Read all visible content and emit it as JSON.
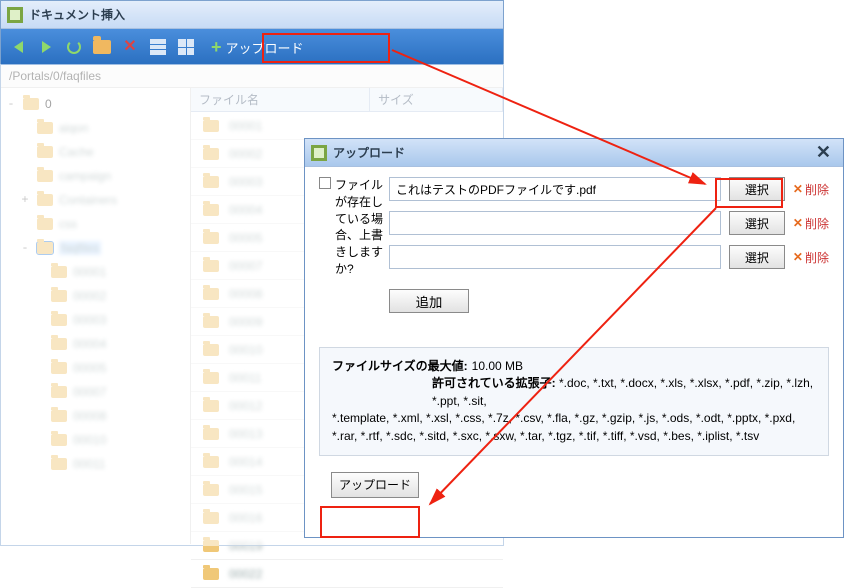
{
  "window": {
    "title": "ドキュメント挿入"
  },
  "toolbar": {
    "upload_label": "アップロード"
  },
  "path": "/Portals/0/faqfiles",
  "tree": {
    "root": "0",
    "items": [
      {
        "label": "aiqon",
        "depth": 1,
        "exp": null,
        "blur": true
      },
      {
        "label": "Cache",
        "depth": 1,
        "exp": null,
        "blur": true
      },
      {
        "label": "campaign",
        "depth": 1,
        "exp": null,
        "blur": true
      },
      {
        "label": "Containers",
        "depth": 1,
        "exp": "+",
        "blur": true
      },
      {
        "label": "css",
        "depth": 1,
        "exp": null,
        "blur": true
      },
      {
        "label": "faqfiles",
        "depth": 1,
        "exp": "-",
        "blur": true,
        "selected": true
      },
      {
        "label": "00001",
        "depth": 2,
        "exp": null,
        "blur": true
      },
      {
        "label": "00002",
        "depth": 2,
        "exp": null,
        "blur": true
      },
      {
        "label": "00003",
        "depth": 2,
        "exp": null,
        "blur": true
      },
      {
        "label": "00004",
        "depth": 2,
        "exp": null,
        "blur": true
      },
      {
        "label": "00005",
        "depth": 2,
        "exp": null,
        "blur": true
      },
      {
        "label": "00007",
        "depth": 2,
        "exp": null,
        "blur": true
      },
      {
        "label": "00008",
        "depth": 2,
        "exp": null,
        "blur": true
      },
      {
        "label": "00010",
        "depth": 2,
        "exp": null,
        "blur": true
      },
      {
        "label": "00011",
        "depth": 2,
        "exp": null,
        "blur": true
      }
    ]
  },
  "filepane": {
    "col_name": "ファイル名",
    "col_size": "サイズ",
    "rows": [
      "00001",
      "00002",
      "00003",
      "00004",
      "00005",
      "00007",
      "00008",
      "00009",
      "00010",
      "00011",
      "00012",
      "00013",
      "00014",
      "00015",
      "00016",
      "00019",
      "00022"
    ]
  },
  "dialog": {
    "title": "アップロード",
    "overwrite_prefix": "ファイルが存在している場合、上書きしますか?",
    "rows": [
      {
        "value": "これはテストのPDFファイルです.pdf"
      },
      {
        "value": ""
      },
      {
        "value": ""
      }
    ],
    "select_label": "選択",
    "delete_label": "削除",
    "add_label": "追加",
    "maxsize_label": "ファイルサイズの最大値:",
    "maxsize_value": "10.00 MB",
    "allowed_label": "許可されている拡張子:",
    "allowed_value_1": "*.doc, *.txt, *.docx, *.xls, *.xlsx, *.pdf, *.zip, *.lzh, *.ppt, *.sit,",
    "allowed_value_2": "*.template, *.xml, *.xsl, *.css, *.7z, *.csv, *.fla, *.gz, *.gzip, *.js, *.ods, *.odt, *.pptx, *.pxd, *.rar, *.rtf, *.sdc, *.sitd, *.sxc, *.sxw, *.tar, *.tgz, *.tif, *.tiff, *.vsd, *.bes, *.iplist, *.tsv",
    "submit_label": "アップロード"
  }
}
